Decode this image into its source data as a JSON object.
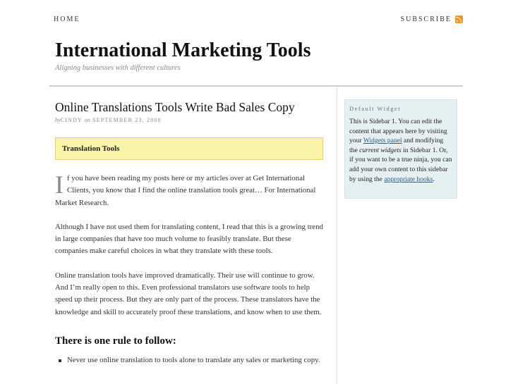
{
  "nav": {
    "home": "HOME",
    "subscribe": "SUBSCRIBE"
  },
  "site": {
    "title": "International Marketing Tools",
    "tagline": "Aligning businesses with different cultures"
  },
  "post": {
    "title": "Online Translations Tools Write Bad Sales Copy",
    "meta_by": "by",
    "author": "CINDY",
    "meta_on": "on",
    "date": "SEPTEMBER 23, 2008",
    "callout": "Translation Tools",
    "dropcap": "I",
    "p1": "f you have been reading my posts here or my articles over at Get International Clients, you know that I find the online translation tools great… For International Market Research.",
    "p2": "Although I have not used them for translating content, I read that this is a growing trend in large companies that have too much volume to feasibly translate. But these companies make careful choices in what they translate with these tools.",
    "p3": "Online translation tools have improved dramatically. Their use will continue to grow. And I’m really open to this. Even professional translators use software tools to help speed up their process. But they are only part of the process. These translators have the knowledge and skill to accurately proof these translations, and know when to use them.",
    "h3": "There is one rule to follow:",
    "rules": [
      "Never use online translation to tools alone to translate any sales or marketing copy."
    ]
  },
  "sidebar": {
    "title": "Default Widget",
    "t1": "This is Sidebar 1. You can edit the content that appears here by visiting your ",
    "link1": "Widgets panel",
    "t2": " and modifying the ",
    "em": "current widgets",
    "t3": " in Sidebar 1. Or, if you want to be a true ninja, you can add your own content to this sidebar by using the ",
    "link2": "appropriate hooks",
    "t4": "."
  },
  "colors": {
    "callout_bg": "#fbf3a7",
    "sidebar_bg": "#e6f0f1",
    "rss": "#f79421",
    "link": "#2a5a88"
  },
  "icons": {
    "feed": "rss-feed-icon"
  }
}
